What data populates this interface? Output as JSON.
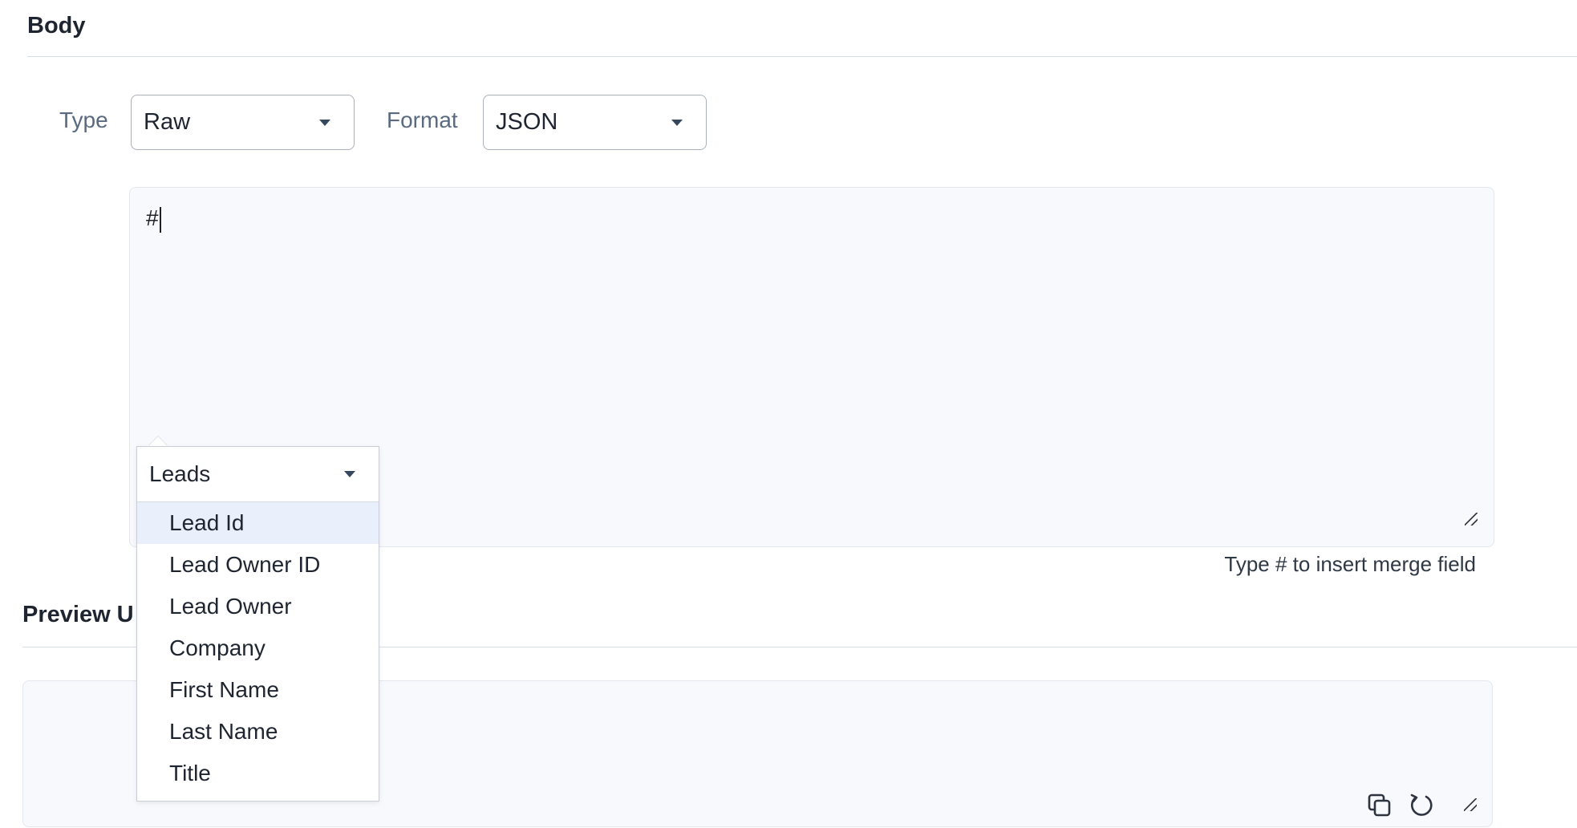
{
  "body_section": {
    "title": "Body",
    "type_label": "Type",
    "type_value": "Raw",
    "format_label": "Format",
    "format_value": "JSON",
    "editor_text": "#",
    "hint": "Type # to insert merge field"
  },
  "merge_dropdown": {
    "module": "Leads",
    "items": [
      "Lead Id",
      "Lead Owner ID",
      "Lead Owner",
      "Company",
      "First Name",
      "Last Name",
      "Title"
    ],
    "highlighted_index": 0
  },
  "preview_section": {
    "title": "Preview URL",
    "visible_title": "Preview U"
  },
  "icons": [
    "chevron-down-icon",
    "copy-icon",
    "refresh-icon",
    "resize-grip-icon"
  ],
  "colors": {
    "editor_bg": "#f8f9fd",
    "highlight_bg": "#e9f0fb",
    "divider": "#d7dde6",
    "label": "#5a6a80"
  }
}
